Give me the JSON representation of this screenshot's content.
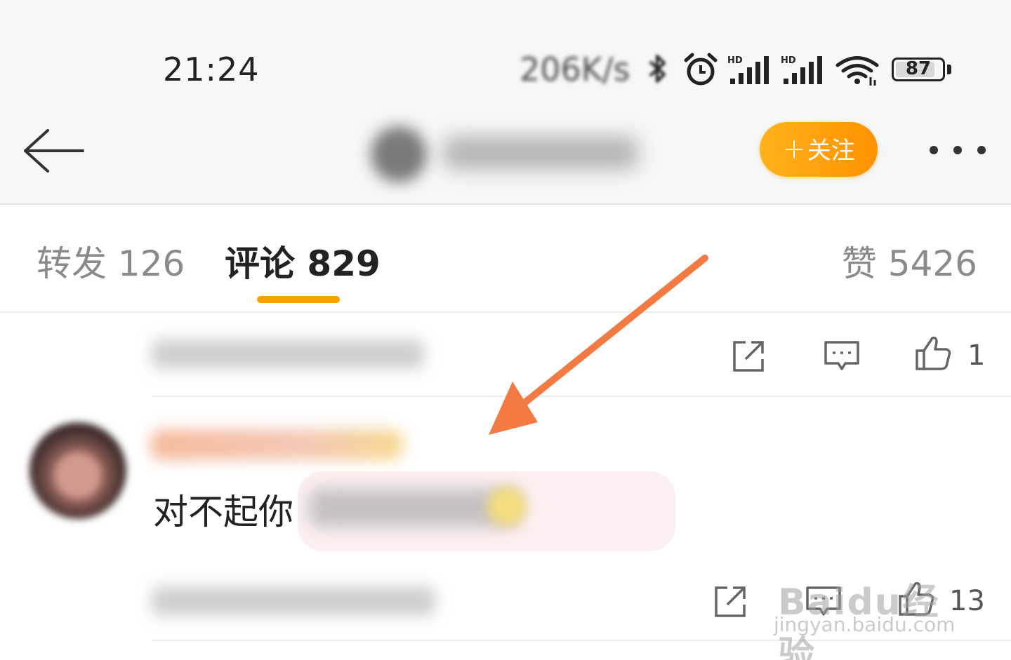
{
  "status_bar": {
    "time": "21:24",
    "net_speed": "206K/s",
    "battery_level": "87",
    "icons": [
      "bluetooth-icon",
      "alarm-icon",
      "hd-signal-icon",
      "hd-signal-icon",
      "wifi-icon",
      "battery-icon"
    ]
  },
  "nav": {
    "back_icon": "back-arrow-icon",
    "follow_plus": "+",
    "follow_label": "关注",
    "more_icon": "more-dots-icon"
  },
  "tabs": {
    "repost": "转发 126",
    "comment": "评论 829",
    "like": "赞 5426",
    "active": "comment"
  },
  "comments": [
    {
      "meta_blurred": true,
      "actions": [
        "share-icon",
        "reply-icon",
        "thumbs-up-icon"
      ],
      "like_count": "1"
    },
    {
      "username_blurred": true,
      "text_visible": "对不起你",
      "text_rest_blurred": true,
      "meta_blurred": true,
      "actions": [
        "share-icon",
        "reply-icon",
        "thumbs-up-icon"
      ],
      "like_count": "13"
    }
  ],
  "watermark": {
    "logo": "Baidu经验",
    "url": "jingyan.baidu.com"
  },
  "colors": {
    "accent_orange": "#f7a100",
    "follow_button": "#ff9c0a",
    "annotation_arrow": "#f47a44",
    "header_bg": "#f7f7f7"
  }
}
